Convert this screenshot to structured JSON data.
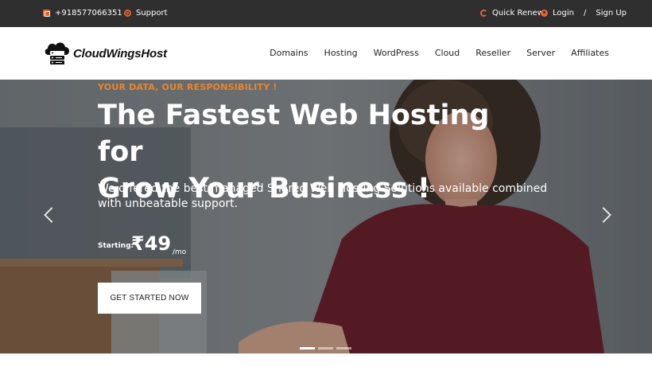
{
  "topbar": {
    "phone": "+918577066351",
    "support": "Support",
    "quick_renew": "Quick Renew",
    "login": "Login",
    "separator": "/",
    "signup": "Sign Up"
  },
  "brand": {
    "name": "CloudWingsHost"
  },
  "nav": {
    "items": [
      "Domains",
      "Hosting",
      "WordPress",
      "Cloud",
      "Reseller",
      "Server",
      "Affiliates"
    ]
  },
  "hero": {
    "kicker": "YOUR DATA, OUR RESPONSIBILITY !",
    "headline_line1": "The Fastest Web Hosting for",
    "headline_line2": "Grow Your Business !",
    "subtext": "We offered the best managed Shared Web Hosting Solutions available combined with unbeatable support.",
    "starting_label": "Starting:",
    "price": "₹49",
    "per": "/mo",
    "cta": "GET STARTED NOW"
  },
  "slider": {
    "slides": 3,
    "active_index": 0
  },
  "colors": {
    "accent": "#e8622c",
    "topbar_bg": "#2f2f2f",
    "kicker": "#e8862c"
  }
}
